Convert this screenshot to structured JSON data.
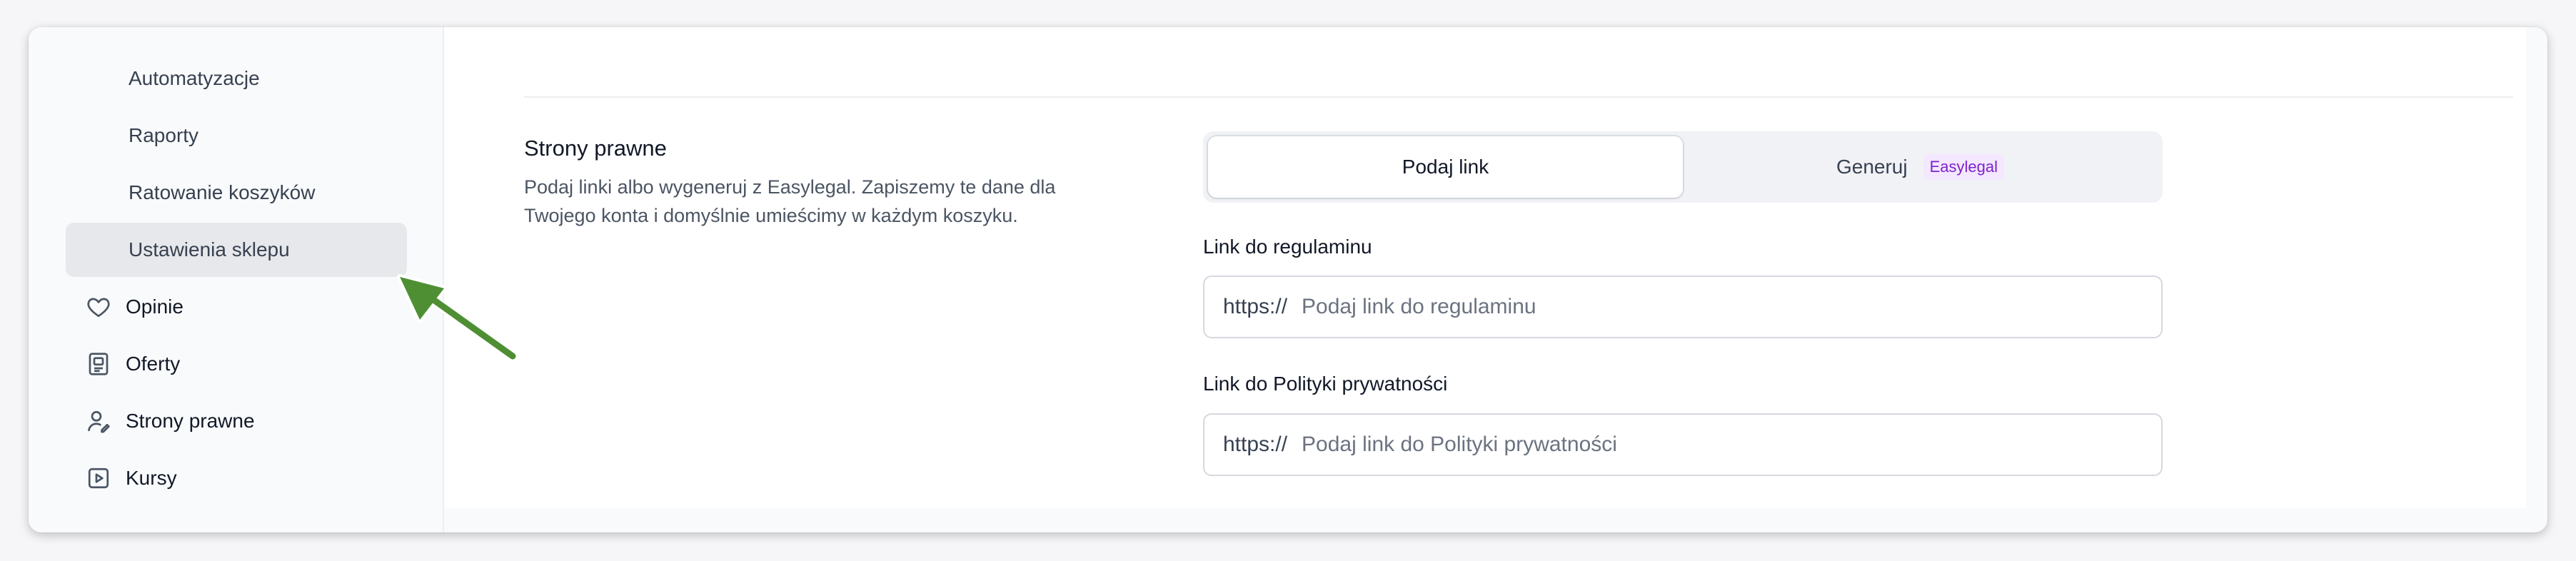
{
  "sidebar": {
    "items": [
      {
        "label": "Automatyzacje"
      },
      {
        "label": "Raporty"
      },
      {
        "label": "Ratowanie koszyków"
      },
      {
        "label": "Ustawienia sklepu"
      },
      {
        "label": "Opinie",
        "icon": "heart-icon"
      },
      {
        "label": "Oferty",
        "icon": "offer-card-icon"
      },
      {
        "label": "Strony prawne",
        "icon": "user-pen-icon"
      },
      {
        "label": "Kursy",
        "icon": "play-square-icon"
      }
    ]
  },
  "section": {
    "title": "Strony prawne",
    "description": "Podaj linki albo wygeneruj z Easylegal. Zapiszemy te dane dla Twojego konta i domyślnie umieścimy w każdym koszyku."
  },
  "mode_toggle": {
    "option_link": "Podaj link",
    "option_generate": "Generuj",
    "generate_badge": "Easylegal",
    "selected": "Podaj link"
  },
  "terms_field": {
    "label": "Link do regulaminu",
    "prefix": "https://",
    "placeholder": "Podaj link do regulaminu",
    "value": ""
  },
  "privacy_field": {
    "label": "Link do Polityki prywatności",
    "prefix": "https://",
    "placeholder": "Podaj link do Polityki prywatności",
    "value": ""
  },
  "colors": {
    "annotation_arrow": "#4e8f34",
    "badge_text": "#7e22ce",
    "active_nav_bg": "#e7e8eb"
  }
}
